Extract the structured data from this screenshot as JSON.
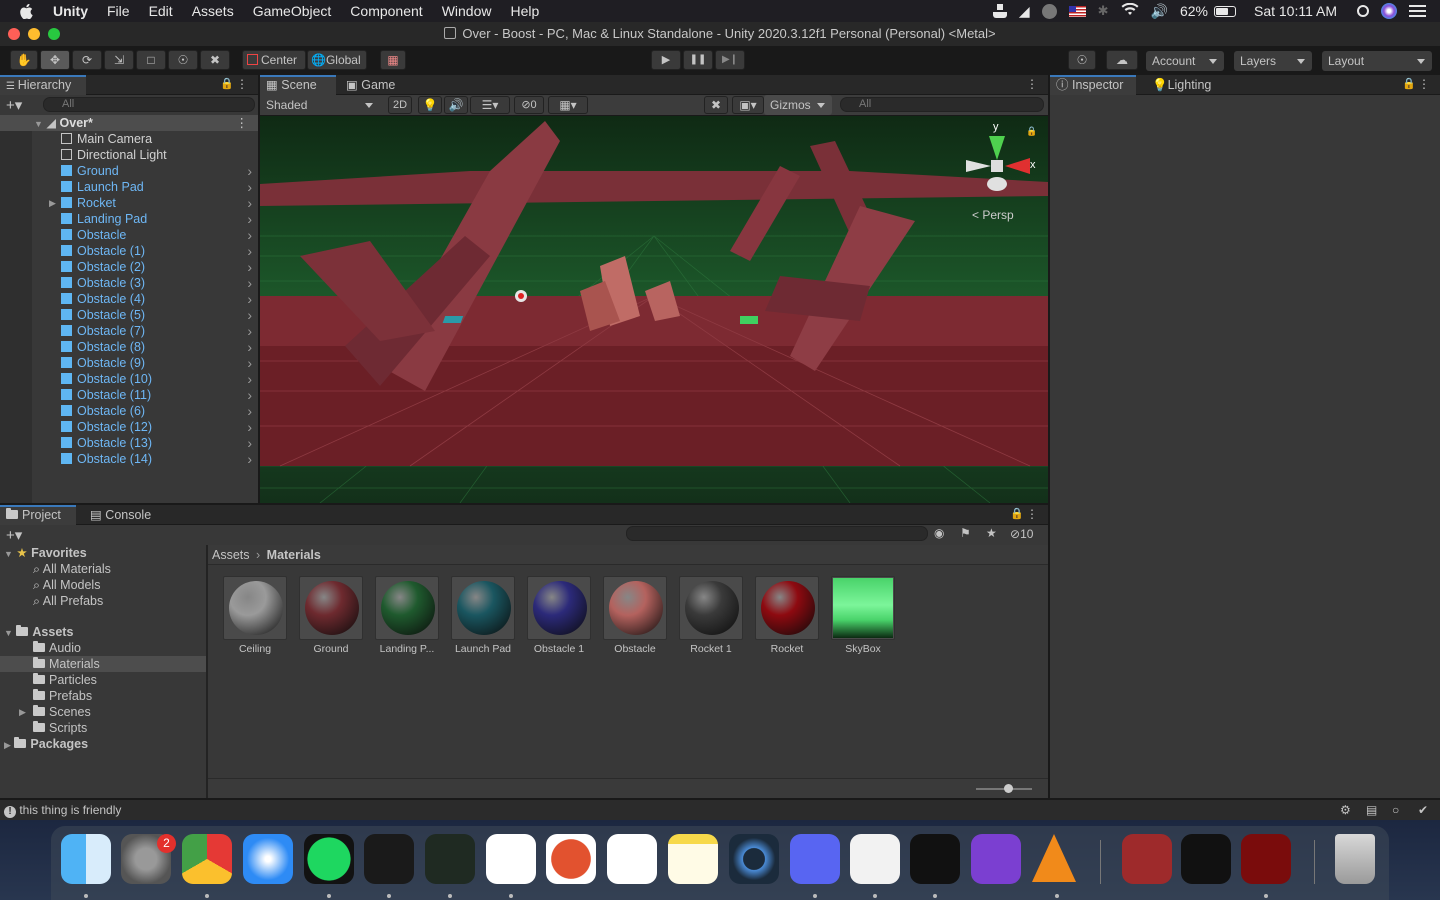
{
  "menubar": {
    "app_name": "Unity",
    "items": [
      "File",
      "Edit",
      "Assets",
      "GameObject",
      "Component",
      "Window",
      "Help"
    ],
    "battery": "62%",
    "clock": "Sat 10:11 AM"
  },
  "window": {
    "title": "Over - Boost - PC, Mac & Linux Standalone - Unity 2020.3.12f1 Personal (Personal) <Metal>"
  },
  "toolbar": {
    "pivot": "Center",
    "space": "Global",
    "account": "Account",
    "layers": "Layers",
    "layout": "Layout"
  },
  "hierarchy": {
    "tab": "Hierarchy",
    "search_placeholder": "All",
    "scene": "Over*",
    "items": [
      {
        "label": "Main Camera",
        "prefab": false
      },
      {
        "label": "Directional Light",
        "prefab": false
      },
      {
        "label": "Ground",
        "prefab": true
      },
      {
        "label": "Launch Pad",
        "prefab": true
      },
      {
        "label": "Rocket",
        "prefab": true
      },
      {
        "label": "Landing Pad",
        "prefab": true
      },
      {
        "label": "Obstacle",
        "prefab": true
      },
      {
        "label": "Obstacle (1)",
        "prefab": true
      },
      {
        "label": "Obstacle (2)",
        "prefab": true
      },
      {
        "label": "Obstacle (3)",
        "prefab": true
      },
      {
        "label": "Obstacle (4)",
        "prefab": true
      },
      {
        "label": "Obstacle (5)",
        "prefab": true
      },
      {
        "label": "Obstacle (7)",
        "prefab": true
      },
      {
        "label": "Obstacle (8)",
        "prefab": true
      },
      {
        "label": "Obstacle (9)",
        "prefab": true
      },
      {
        "label": "Obstacle (10)",
        "prefab": true
      },
      {
        "label": "Obstacle (11)",
        "prefab": true
      },
      {
        "label": "Obstacle (6)",
        "prefab": true
      },
      {
        "label": "Obstacle (12)",
        "prefab": true
      },
      {
        "label": "Obstacle (13)",
        "prefab": true
      },
      {
        "label": "Obstacle (14)",
        "prefab": true
      }
    ]
  },
  "scene_view": {
    "tabs": [
      "Scene",
      "Game"
    ],
    "shading": "Shaded",
    "mode_2d": "2D",
    "hidden_count": "0",
    "gizmos": "Gizmos",
    "search_placeholder": "All",
    "projection": "Persp",
    "axis_y": "y",
    "axis_x": "x"
  },
  "inspector": {
    "tabs": [
      "Inspector",
      "Lighting"
    ]
  },
  "project": {
    "tabs": [
      "Project",
      "Console"
    ],
    "hidden_count": "10",
    "favorites_label": "Favorites",
    "favorites": [
      "All Materials",
      "All Models",
      "All Prefabs"
    ],
    "assets_label": "Assets",
    "folders": [
      "Audio",
      "Materials",
      "Particles",
      "Prefabs",
      "Scenes",
      "Scripts"
    ],
    "packages_label": "Packages",
    "breadcrumb": [
      "Assets",
      "Materials"
    ],
    "materials": [
      {
        "label": "Ceiling",
        "color": "#9a9a9a"
      },
      {
        "label": "Ground",
        "color": "#6e2a2f"
      },
      {
        "label": "Landing P...",
        "color": "#1f5a2e"
      },
      {
        "label": "Launch Pad",
        "color": "#1a5660"
      },
      {
        "label": "Obstacle 1",
        "color": "#2c2a7a"
      },
      {
        "label": "Obstacle",
        "color": "#b4625e"
      },
      {
        "label": "Rocket 1",
        "color": "#3a3a3a"
      },
      {
        "label": "Rocket",
        "color": "#8e0a10"
      },
      {
        "label": "SkyBox",
        "color": "#49d36a"
      }
    ]
  },
  "statusbar": {
    "message": "this thing is friendly"
  },
  "dock": {
    "badge": "2",
    "apps": [
      "finder-icon",
      "system-preferences-icon",
      "chrome-icon",
      "safari-icon",
      "spotify-icon",
      "terminal-icon",
      "activity-monitor-icon",
      "word-icon",
      "powerpoint-icon",
      "excel-icon",
      "notes-icon",
      "quicktime-icon",
      "discord-icon",
      "unity-hub-icon",
      "unity-icon",
      "visual-studio-icon",
      "vlc-icon",
      "dictionary-icon",
      "unity-icon-2",
      "flash-icon",
      "trash-icon"
    ]
  }
}
